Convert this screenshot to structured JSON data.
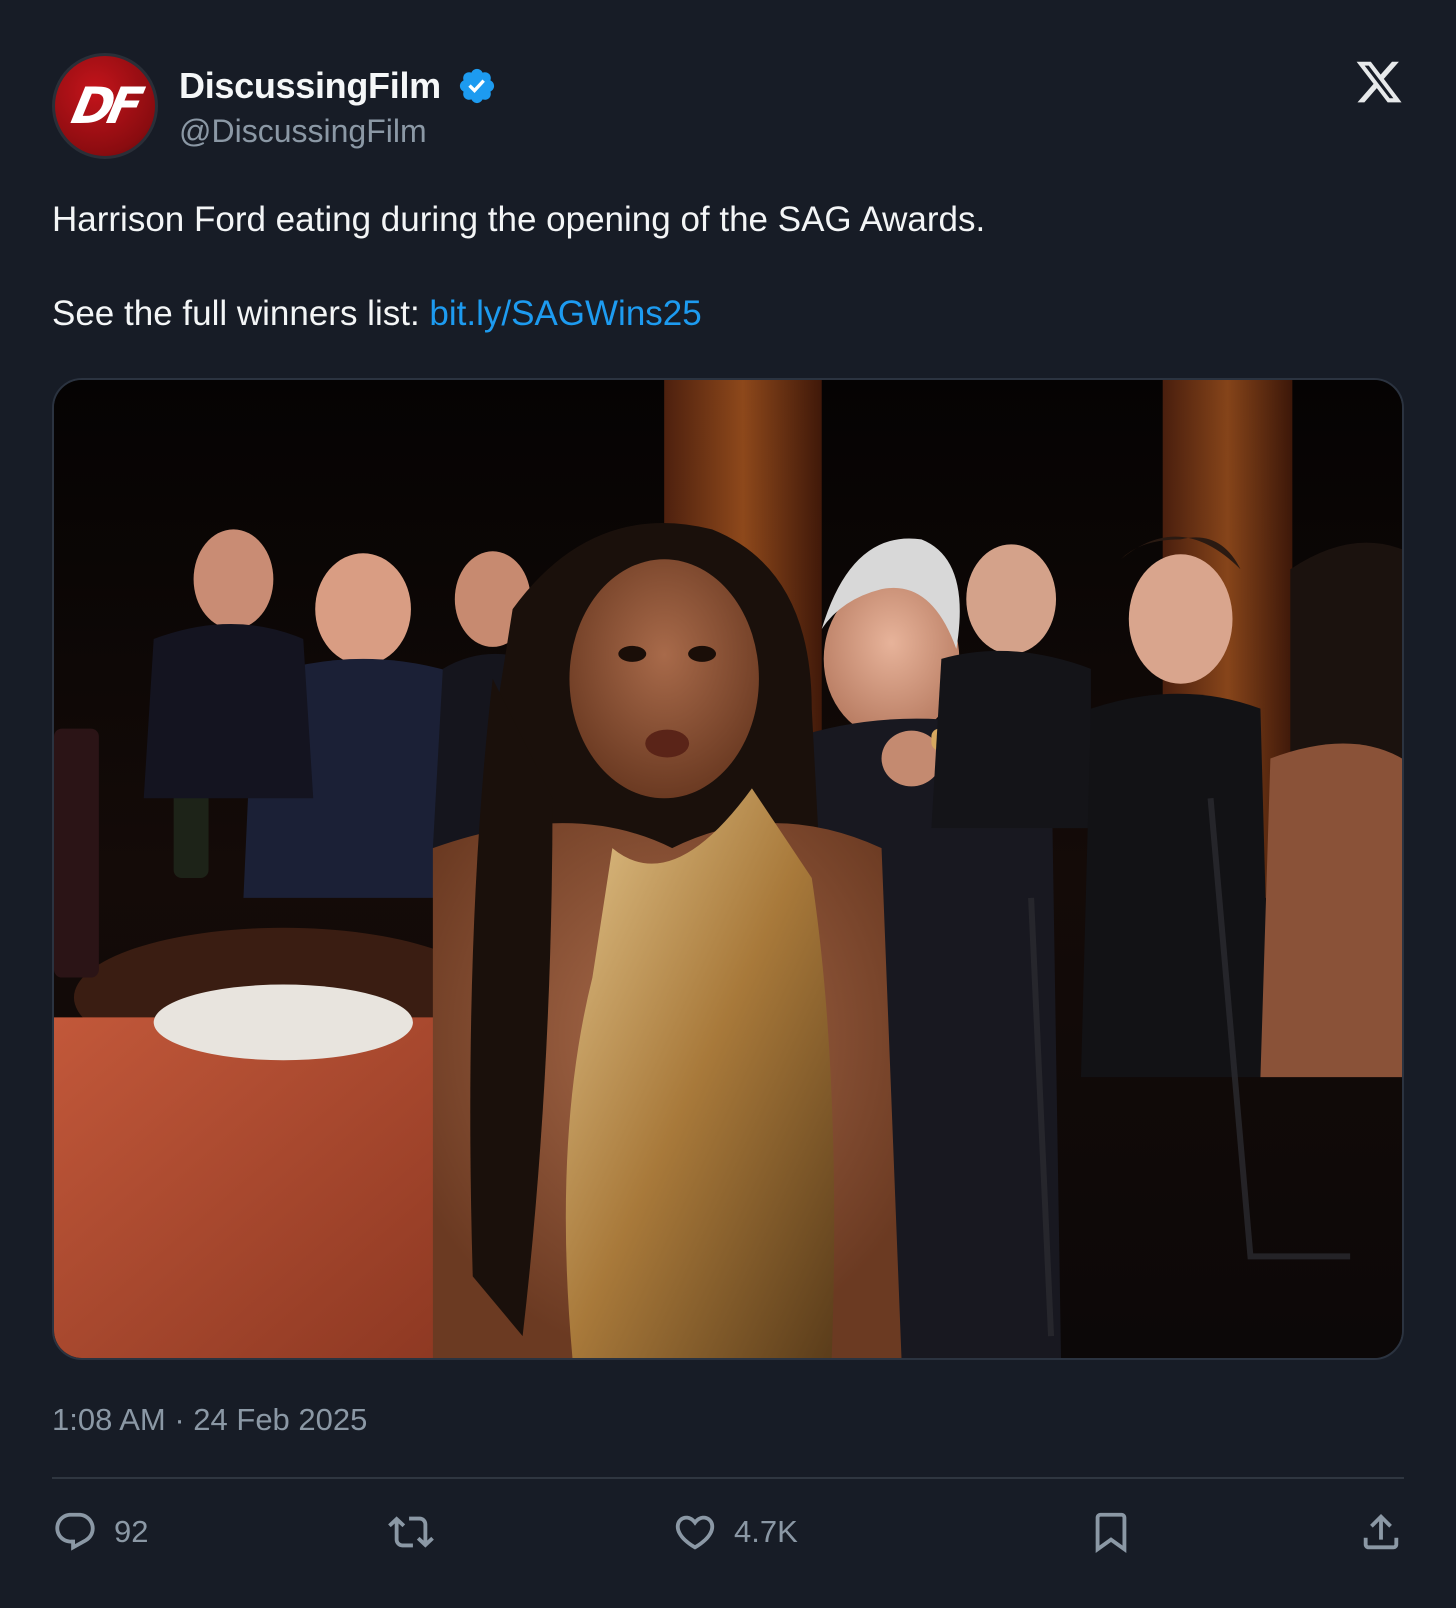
{
  "author": {
    "display_name": "DiscussingFilm",
    "handle": "@DiscussingFilm",
    "avatar_text": "DF",
    "verified_icon": "verified-badge-icon"
  },
  "platform_icon": "x-logo-icon",
  "tweet": {
    "line1": "Harrison Ford eating during the opening of the SAG Awards.",
    "line2_prefix": "See the full winners list: ",
    "link": "bit.ly/SAGWins25"
  },
  "media": {
    "type": "photo",
    "subject": "awards-ceremony-audience"
  },
  "timestamp": "1:08 AM · 24 Feb 2025",
  "actions": {
    "reply": {
      "icon": "reply-icon",
      "count": "92"
    },
    "retweet": {
      "icon": "retweet-icon"
    },
    "like": {
      "icon": "heart-icon",
      "count": "4.7K"
    },
    "bookmark": {
      "icon": "bookmark-icon"
    },
    "share": {
      "icon": "share-icon"
    }
  },
  "colors": {
    "background": "#171c26",
    "link": "#1d9bf0",
    "verified": "#1d9bf0",
    "muted": "#8b98a5",
    "avatar_red": "#c4141b"
  }
}
